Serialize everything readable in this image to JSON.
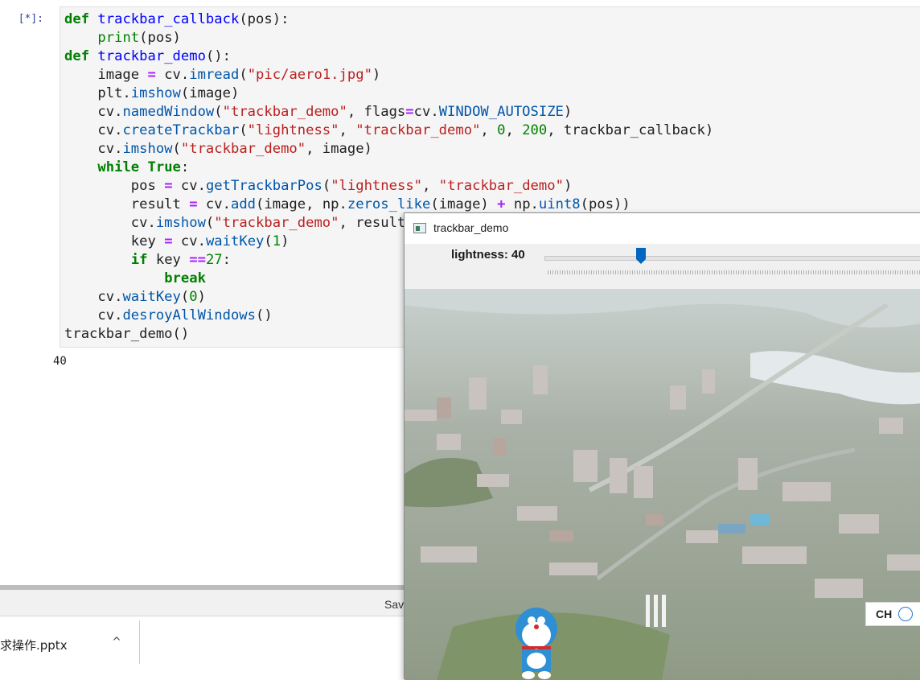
{
  "notebook": {
    "prompt": "[*]:",
    "code_lines": [
      [
        [
          "kw",
          "def "
        ],
        [
          "fn",
          "trackbar_callback"
        ],
        [
          "",
          "(pos):"
        ]
      ],
      [
        [
          "",
          "    "
        ],
        [
          "bi",
          "print"
        ],
        [
          "",
          "(pos)"
        ]
      ],
      [
        [
          "kw",
          "def "
        ],
        [
          "fn",
          "trackbar_demo"
        ],
        [
          "",
          "():"
        ]
      ],
      [
        [
          "",
          "    image "
        ],
        [
          "op",
          "="
        ],
        [
          "",
          " cv."
        ],
        [
          "m",
          "imread"
        ],
        [
          "",
          "("
        ],
        [
          "st",
          "\"pic/aero1.jpg\""
        ],
        [
          "",
          ")"
        ]
      ],
      [
        [
          "",
          "    plt."
        ],
        [
          "m",
          "imshow"
        ],
        [
          "",
          "(image)"
        ]
      ],
      [
        [
          "",
          "    cv."
        ],
        [
          "m",
          "namedWindow"
        ],
        [
          "",
          "("
        ],
        [
          "st",
          "\"trackbar_demo\""
        ],
        [
          "",
          ", flags"
        ],
        [
          "op",
          "="
        ],
        [
          "",
          "cv."
        ],
        [
          "m",
          "WINDOW_AUTOSIZE"
        ],
        [
          "",
          ")"
        ]
      ],
      [
        [
          "",
          "    cv."
        ],
        [
          "m",
          "createTrackbar"
        ],
        [
          "",
          "("
        ],
        [
          "st",
          "\"lightness\""
        ],
        [
          "",
          ", "
        ],
        [
          "st",
          "\"trackbar_demo\""
        ],
        [
          "",
          ", "
        ],
        [
          "nm",
          "0"
        ],
        [
          "",
          ", "
        ],
        [
          "nm",
          "200"
        ],
        [
          "",
          ", trackbar_callback)"
        ]
      ],
      [
        [
          "",
          "    cv."
        ],
        [
          "m",
          "imshow"
        ],
        [
          "",
          "("
        ],
        [
          "st",
          "\"trackbar_demo\""
        ],
        [
          "",
          ", image)"
        ]
      ],
      [
        [
          "",
          "    "
        ],
        [
          "kw",
          "while "
        ],
        [
          "kw",
          "True"
        ],
        [
          "",
          ":"
        ]
      ],
      [
        [
          "",
          "        pos "
        ],
        [
          "op",
          "="
        ],
        [
          "",
          " cv."
        ],
        [
          "m",
          "getTrackbarPos"
        ],
        [
          "",
          "("
        ],
        [
          "st",
          "\"lightness\""
        ],
        [
          "",
          ", "
        ],
        [
          "st",
          "\"trackbar_demo\""
        ],
        [
          "",
          ")"
        ]
      ],
      [
        [
          "",
          "        result "
        ],
        [
          "op",
          "="
        ],
        [
          "",
          " cv."
        ],
        [
          "m",
          "add"
        ],
        [
          "",
          "(image, np."
        ],
        [
          "m",
          "zeros_like"
        ],
        [
          "",
          "(image) "
        ],
        [
          "op",
          "+"
        ],
        [
          "",
          " np."
        ],
        [
          "m",
          "uint8"
        ],
        [
          "",
          "(pos))"
        ]
      ],
      [
        [
          "",
          "        cv."
        ],
        [
          "m",
          "imshow"
        ],
        [
          "",
          "("
        ],
        [
          "st",
          "\"trackbar_demo\""
        ],
        [
          "",
          ", result)"
        ]
      ],
      [
        [
          "",
          "        key "
        ],
        [
          "op",
          "="
        ],
        [
          "",
          " cv."
        ],
        [
          "m",
          "waitKey"
        ],
        [
          "",
          "("
        ],
        [
          "nm",
          "1"
        ],
        [
          "",
          ")"
        ]
      ],
      [
        [
          "",
          "        "
        ],
        [
          "kw",
          "if "
        ],
        [
          "",
          "key "
        ],
        [
          "op",
          "=="
        ],
        [
          "",
          "",
          " "
        ],
        [
          "nm",
          "27"
        ],
        [
          "",
          ":"
        ]
      ],
      [
        [
          "",
          "            "
        ],
        [
          "kw",
          "break"
        ]
      ],
      [
        [
          "",
          "    cv."
        ],
        [
          "m",
          "waitKey"
        ],
        [
          "",
          "("
        ],
        [
          "nm",
          "0"
        ],
        [
          "",
          ")"
        ]
      ],
      [
        [
          "",
          "    cv."
        ],
        [
          "m",
          "desroyAllWindows"
        ],
        [
          "",
          "()"
        ]
      ],
      [
        [
          "",
          "trackbar_demo()"
        ]
      ]
    ],
    "output": "40"
  },
  "download_bar": {
    "save_label": "Sav",
    "file_name": "求操作.pptx",
    "caret": "^"
  },
  "cv_window": {
    "title": "trackbar_demo",
    "trackbar": {
      "label": "lightness: 40",
      "value": 40,
      "min": 0,
      "max": 200
    }
  },
  "ime": {
    "text": "CH"
  },
  "colors": {
    "prompt": "#303f9f",
    "keyword": "#008000",
    "string": "#ba2121",
    "thumb": "#0067c0"
  }
}
